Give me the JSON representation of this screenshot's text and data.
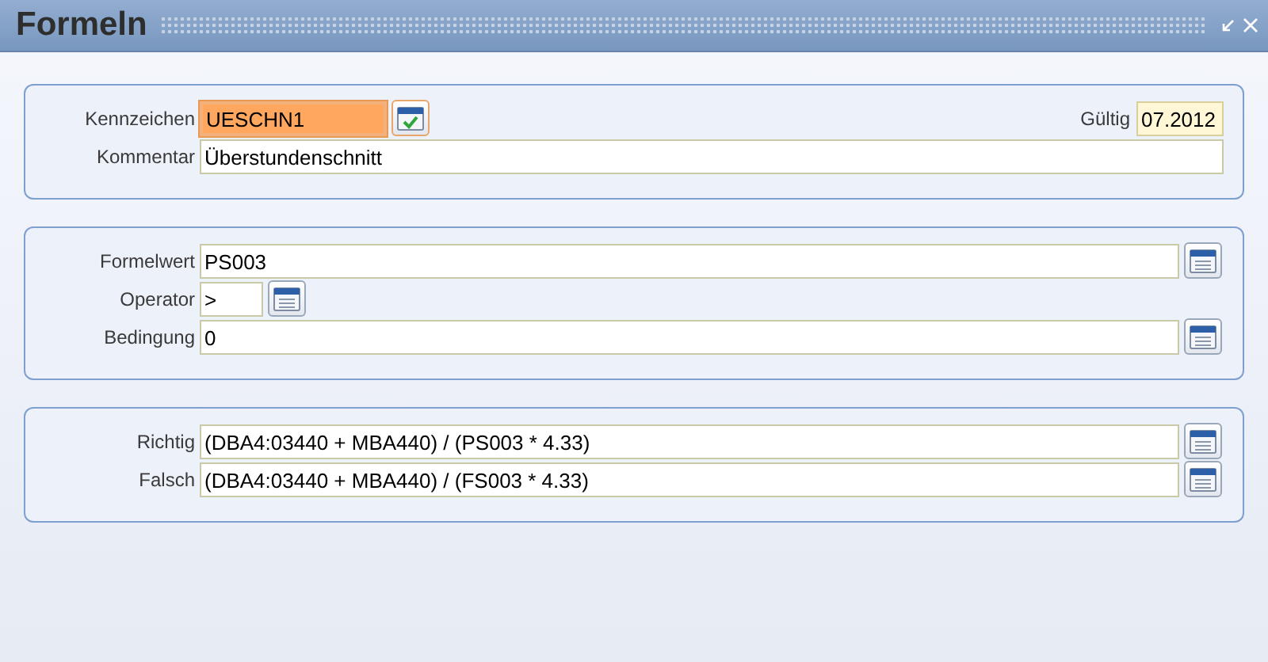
{
  "window": {
    "title": "Formeln"
  },
  "sections": [
    {
      "rows": [
        {
          "kind": "code",
          "label": "Kennzeichen",
          "value": "UESCHN1",
          "focused": true,
          "extra": {
            "label": "Gültig",
            "value": "07.2012"
          }
        },
        {
          "kind": "text",
          "label": "Kommentar",
          "value": "Überstundenschnitt",
          "focused": false
        }
      ]
    },
    {
      "rows": [
        {
          "kind": "formula",
          "label": "Formelwert",
          "value": "PS003",
          "focused": false
        },
        {
          "kind": "operator",
          "label": "Operator",
          "value": ">",
          "focused": false
        },
        {
          "kind": "formula",
          "label": "Bedingung",
          "value": "0",
          "focused": false
        }
      ]
    },
    {
      "rows": [
        {
          "kind": "formula",
          "label": "Richtig",
          "value": "(DBA4:03440 + MBA440) / (PS003 * 4.33)",
          "focused": false
        },
        {
          "kind": "formula",
          "label": "Falsch",
          "value": "(DBA4:03440 + MBA440) / (FS003 * 4.33)",
          "focused": false
        }
      ]
    }
  ]
}
